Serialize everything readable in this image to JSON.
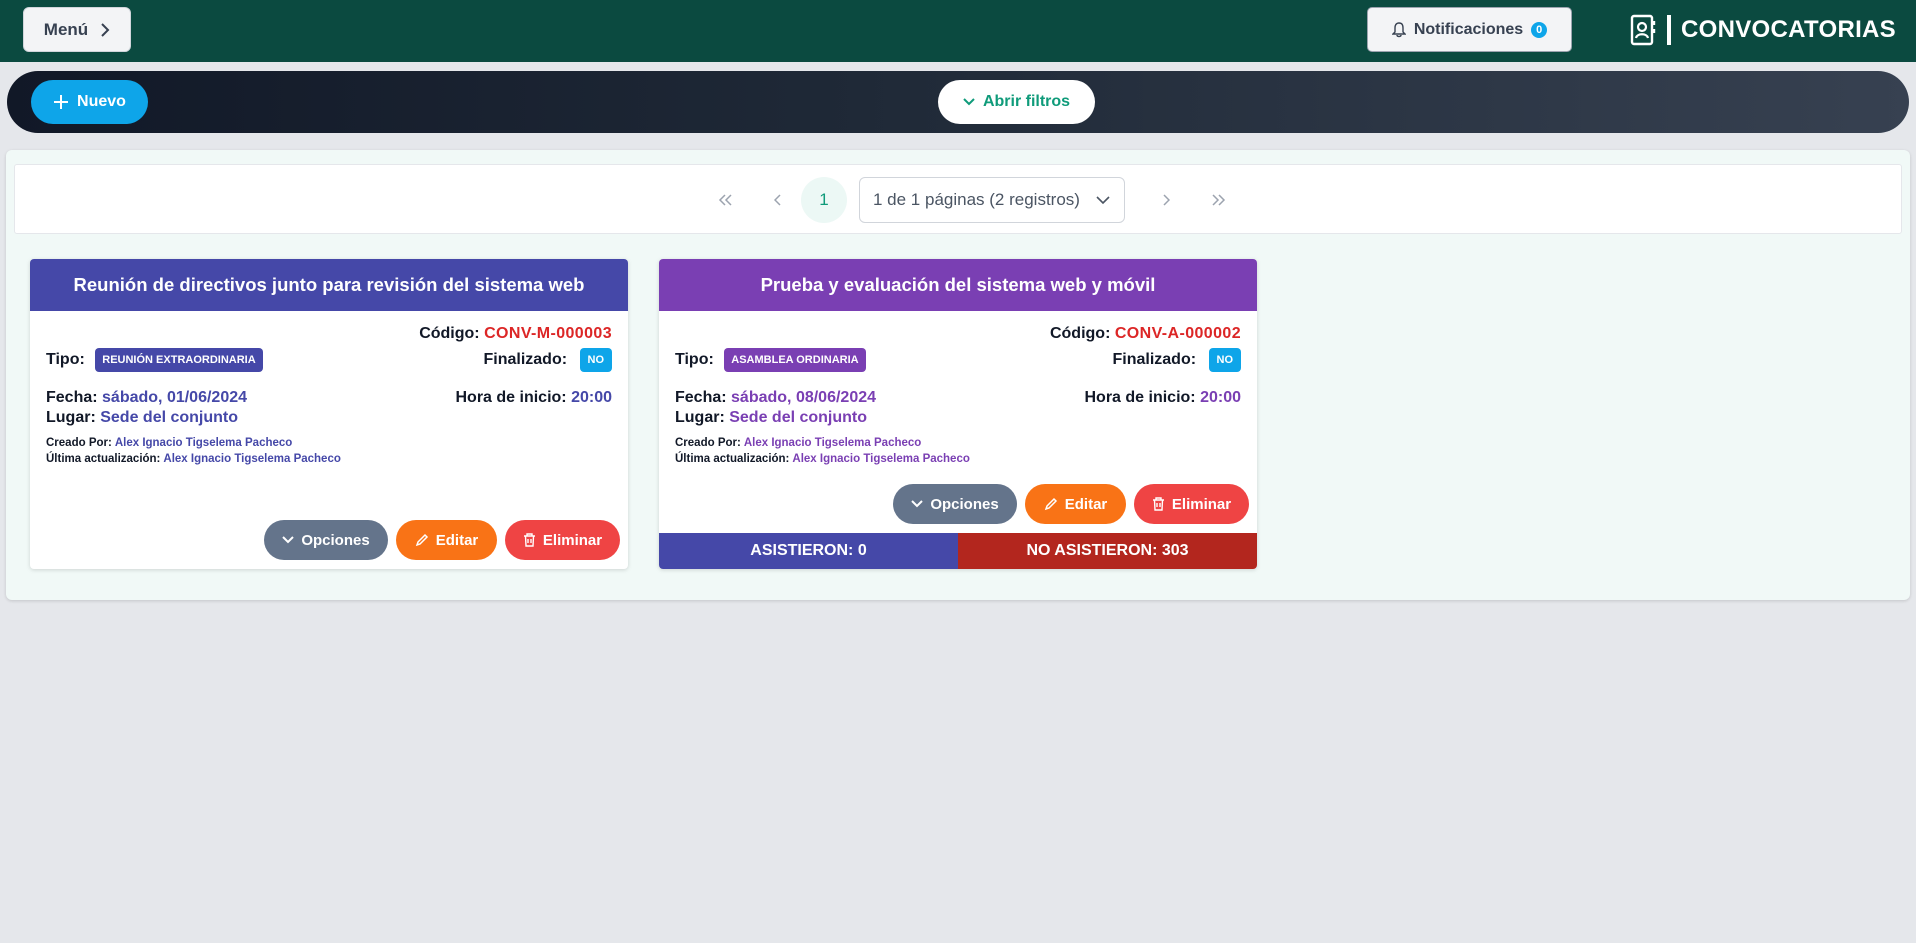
{
  "topbar": {
    "menu_label": "Menú",
    "notifications_label": "Notificaciones",
    "notifications_count": "0",
    "section_title": "CONVOCATORIAS"
  },
  "actions": {
    "new_label": "Nuevo",
    "filters_label": "Abrir filtros"
  },
  "pagination": {
    "current_page": "1",
    "summary": "1 de 1 páginas (2 registros)"
  },
  "labels": {
    "code": "Código:",
    "type": "Tipo:",
    "finished": "Finalizado:",
    "date": "Fecha:",
    "start_time": "Hora de inicio:",
    "place": "Lugar:",
    "created_by": "Creado Por:",
    "updated_by": "Última actualización:",
    "options": "Opciones",
    "edit": "Editar",
    "delete": "Eliminar"
  },
  "cards": [
    {
      "title": "Reunión de directivos junto para revisión del sistema web",
      "code": "CONV-M-000003",
      "type": "REUNIÓN EXTRAORDINARIA",
      "finished": "NO",
      "date": "sábado, 01/06/2024",
      "start_time": "20:00",
      "place": "Sede del conjunto",
      "created_by": "Alex Ignacio Tigselema Pacheco",
      "updated_by": "Alex Ignacio Tigselema Pacheco",
      "accent_color": "#4548a8"
    },
    {
      "title": "Prueba y evaluación del sistema web y móvil",
      "code": "CONV-A-000002",
      "type": "ASAMBLEA ORDINARIA",
      "finished": "NO",
      "date": "sábado, 08/06/2024",
      "start_time": "20:00",
      "place": "Sede del conjunto",
      "created_by": "Alex Ignacio Tigselema Pacheco",
      "updated_by": "Alex Ignacio Tigselema Pacheco",
      "accent_color": "#7a3fb3",
      "attended_label": "ASISTIERON: 0",
      "not_attended_label": "NO ASISTIERON: 303"
    }
  ],
  "colors": {
    "topbar": "#0b4a40",
    "primary_button": "#0ea5e9",
    "filters_text": "#0f9b7a",
    "code_red": "#dc2626",
    "attended_bg": "#4548a8",
    "not_attended_bg": "#b3261e"
  },
  "icons": [
    "chevron-right-icon",
    "bell-icon",
    "contacts-book-icon",
    "plus-icon",
    "chevron-down-icon",
    "double-chevron-left-icon",
    "chevron-left-icon",
    "double-chevron-right-icon",
    "pencil-icon",
    "trash-icon"
  ]
}
